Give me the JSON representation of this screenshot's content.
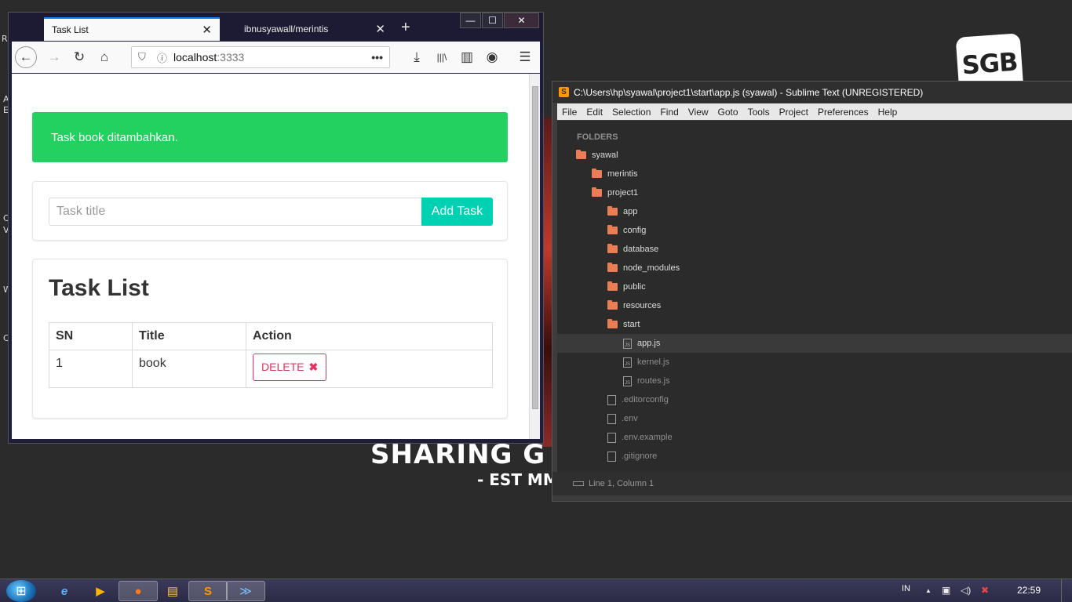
{
  "desktop": {
    "fragments": [
      "R",
      "A",
      "E",
      "C",
      "V",
      "W",
      "C"
    ],
    "logo_text": "SGB",
    "banner_text": "SHARING G",
    "banner_sub": "- EST MM"
  },
  "firefox": {
    "window_controls": {
      "minimize": "—",
      "maximize": "☐",
      "close": "✕"
    },
    "tabs": [
      {
        "title": "Task List",
        "close": "✕"
      },
      {
        "title": "ibnusyawall/merintis",
        "close": "✕"
      }
    ],
    "new_tab": "+",
    "nav": {
      "back": "←",
      "forward": "→",
      "reload": "↻",
      "home": "⌂",
      "url_host": "localhost",
      "url_port": ":3333",
      "page_actions": "•••",
      "download": "⤓",
      "library": "|||\\",
      "sidebar": "▥",
      "account": "◉",
      "menu": "☰"
    },
    "page": {
      "alert": "Task book ditambahkan.",
      "input_placeholder": "Task title",
      "add_button": "Add Task",
      "list_title": "Task List",
      "table": {
        "headers": [
          "SN",
          "Title",
          "Action"
        ],
        "rows": [
          {
            "sn": "1",
            "title": "book",
            "action": "DELETE"
          }
        ]
      },
      "delete_icon": "✖"
    },
    "colors": {
      "alert_bg": "#23d160",
      "primary_btn": "#00d1b2",
      "danger": "#e0355f"
    }
  },
  "sublime": {
    "title": "C:\\Users\\hp\\syawal\\project1\\start\\app.js (syawal) - Sublime Text (UNREGISTERED)",
    "logo": "S",
    "menu": [
      "File",
      "Edit",
      "Selection",
      "Find",
      "View",
      "Goto",
      "Tools",
      "Project",
      "Preferences",
      "Help"
    ],
    "sidebar_header": "FOLDERS",
    "tree": [
      {
        "name": "syawal",
        "type": "folder"
      },
      {
        "name": "merintis",
        "type": "folder"
      },
      {
        "name": "project1",
        "type": "folder"
      },
      {
        "name": "app",
        "type": "folder"
      },
      {
        "name": "config",
        "type": "folder"
      },
      {
        "name": "database",
        "type": "folder"
      },
      {
        "name": "node_modules",
        "type": "folder"
      },
      {
        "name": "public",
        "type": "folder"
      },
      {
        "name": "resources",
        "type": "folder"
      },
      {
        "name": "start",
        "type": "folder"
      },
      {
        "name": "app.js",
        "type": "file",
        "selected": true
      },
      {
        "name": "kernel.js",
        "type": "file"
      },
      {
        "name": "routes.js",
        "type": "file"
      },
      {
        "name": ".editorconfig",
        "type": "file"
      },
      {
        "name": ".env",
        "type": "file"
      },
      {
        "name": ".env.example",
        "type": "file"
      },
      {
        "name": ".gitignore",
        "type": "file"
      }
    ],
    "status": "Line 1, Column 1"
  },
  "taskbar": {
    "start": "⊞",
    "apps": [
      {
        "name": "internet-explorer",
        "glyph": "e"
      },
      {
        "name": "media-player",
        "glyph": "▶"
      },
      {
        "name": "firefox",
        "glyph": "●"
      },
      {
        "name": "file-explorer",
        "glyph": "▤"
      },
      {
        "name": "sublime-text",
        "glyph": "S"
      },
      {
        "name": "powershell",
        "glyph": "≫"
      }
    ],
    "lang": "IN",
    "tray": {
      "up": "▲",
      "network": "▣",
      "volume": "◁)",
      "power": "✖"
    },
    "clock": "22:59"
  }
}
